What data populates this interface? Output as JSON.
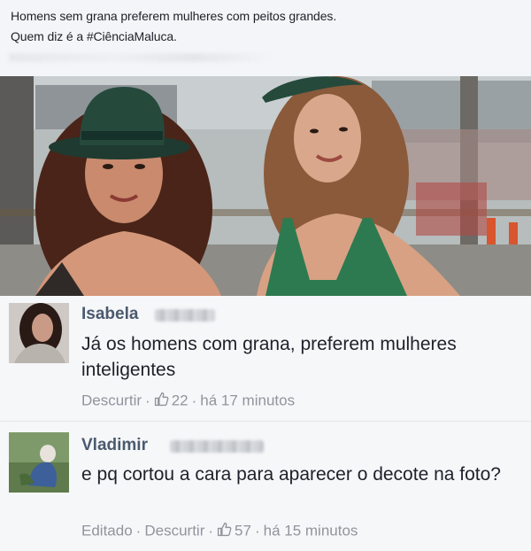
{
  "post": {
    "line1": "Homens sem grana preferem mulheres com peitos grandes.",
    "line2": "Quem diz é a #CiênciaMaluca."
  },
  "comments": [
    {
      "author": "Isabela",
      "text": "Já os homens com grana, preferem mulheres inteligentes",
      "actions": {
        "uncurtir": "Descurtir",
        "likes": "22",
        "time": "há 17 minutos"
      },
      "avatar_icon": "profile-photo-woman"
    },
    {
      "author": "Vladimir",
      "text": "e pq cortou a cara para aparecer o decote na foto?",
      "actions": {
        "edited": "Editado",
        "uncurtir": "Descurtir",
        "likes": "57",
        "time": "há 15 minutos"
      },
      "avatar_icon": "profile-photo-outdoor"
    }
  ],
  "colors": {
    "author": "#4a5a6e",
    "meta": "#90949c",
    "comment_bg": "#f6f7f9",
    "header_bg": "#f4f5f8"
  },
  "icons": {
    "like": "thumbs-up-icon"
  }
}
